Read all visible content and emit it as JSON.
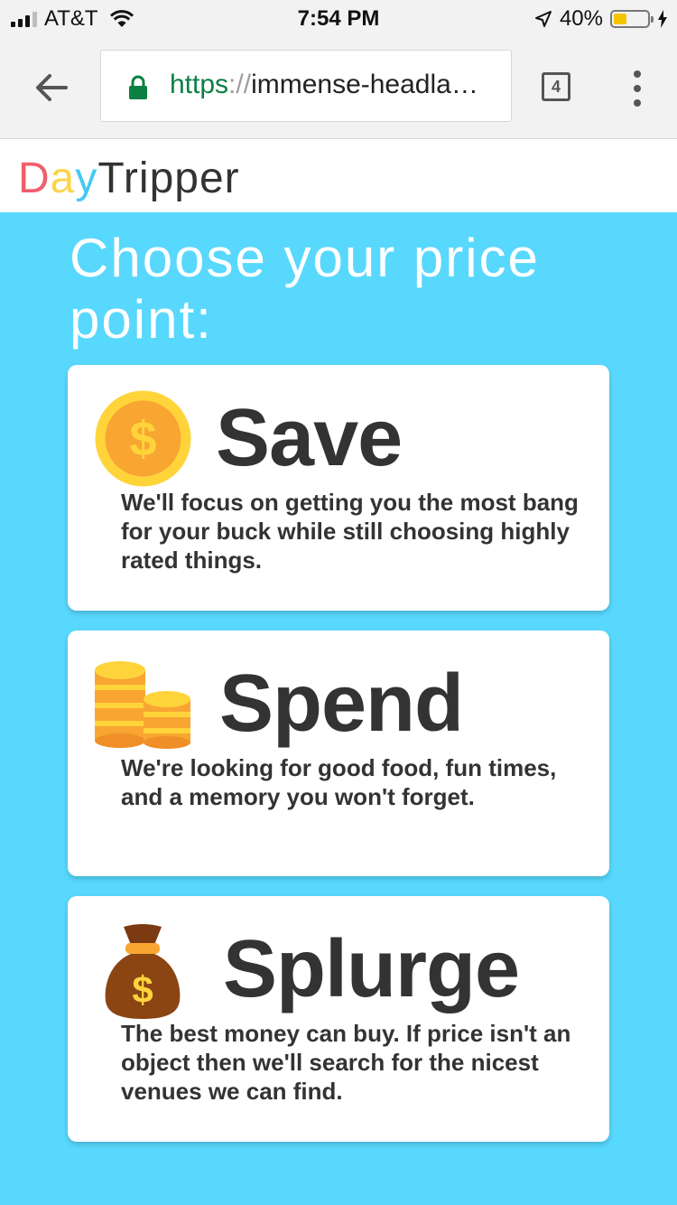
{
  "status_bar": {
    "carrier": "AT&T",
    "time": "7:54 PM",
    "battery": "40%",
    "battery_level": 0.4
  },
  "browser": {
    "url_scheme": "https",
    "url_sep": "://",
    "url_host": "immense-headla…",
    "tab_count": "4"
  },
  "site": {
    "logo_part_d": "D",
    "logo_part_a": "a",
    "logo_part_y": "y",
    "logo_part_rest": "Tripper"
  },
  "page": {
    "heading": "Choose your price point:"
  },
  "options": [
    {
      "title": "Save",
      "icon": "gold-coin-icon",
      "description": "We'll focus on getting you the most bang for your buck while still choosing highly rated things."
    },
    {
      "title": "Spend",
      "icon": "coin-stacks-icon",
      "description": "We're looking for good food, fun times, and a memory you won't forget."
    },
    {
      "title": "Splurge",
      "icon": "money-bag-icon",
      "description": "The best money can buy. If price isn't an object then we'll search for the nicest venues we can find."
    }
  ],
  "colors": {
    "page_background": "#58d8fd",
    "logo_d": "#ef5f6b",
    "logo_a": "#fbd54a",
    "logo_y": "#45c9f5",
    "secure_green": "#0b8043"
  }
}
